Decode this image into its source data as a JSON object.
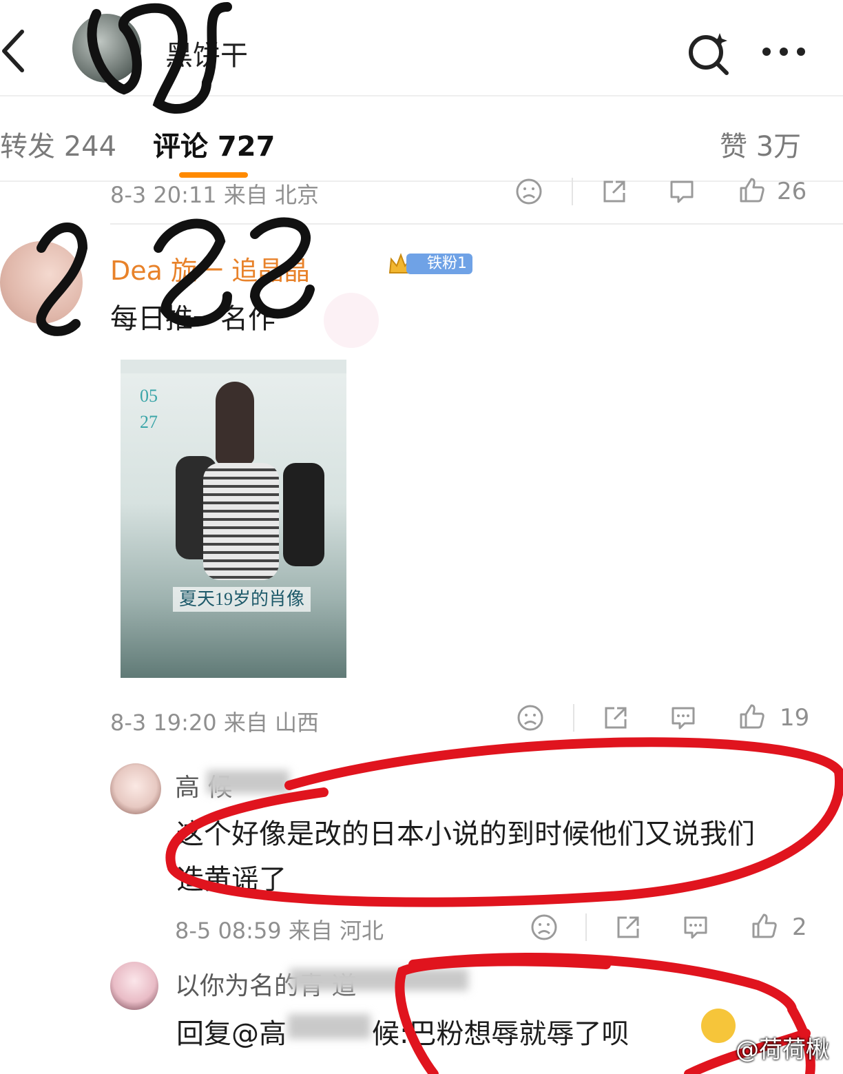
{
  "topbar": {
    "title": "黑饼干",
    "back_icon": "chevron-left-icon",
    "search_icon": "search-sparkle-icon",
    "more_icon": "more-dots-icon"
  },
  "tabs": [
    {
      "label": "转发 244"
    },
    {
      "label": "评论 727"
    },
    {
      "label": "赞 3万"
    }
  ],
  "prev_comment": {
    "meta": "8-3 20:11 来自 北京",
    "likes": "26"
  },
  "comment1": {
    "username": "Dea  旋一 追晶晶",
    "badge": "铁粉1",
    "text": "每日推一名作",
    "image": {
      "date_top": "05",
      "date_bottom": "27",
      "title_text": "夏天19岁的肖像"
    },
    "meta": "8-3 19:20 来自 山西",
    "likes": "19"
  },
  "comment2": {
    "username": "高 候",
    "text_line1": "这个好像是改的日本小说的到时候他们又说我们",
    "text_line2": "造黄谣了",
    "meta": "8-5 08:59 来自 河北",
    "likes": "2"
  },
  "comment3": {
    "username": "以你为名的青 道",
    "reply_prefix": "回复@高",
    "reply_rest": "候:巴粉想辱就辱了呗"
  },
  "watermark": "@荷荷楸",
  "colors": {
    "accent": "#ff8a00",
    "username": "#e8822a",
    "annotation_red": "#e0141e"
  }
}
